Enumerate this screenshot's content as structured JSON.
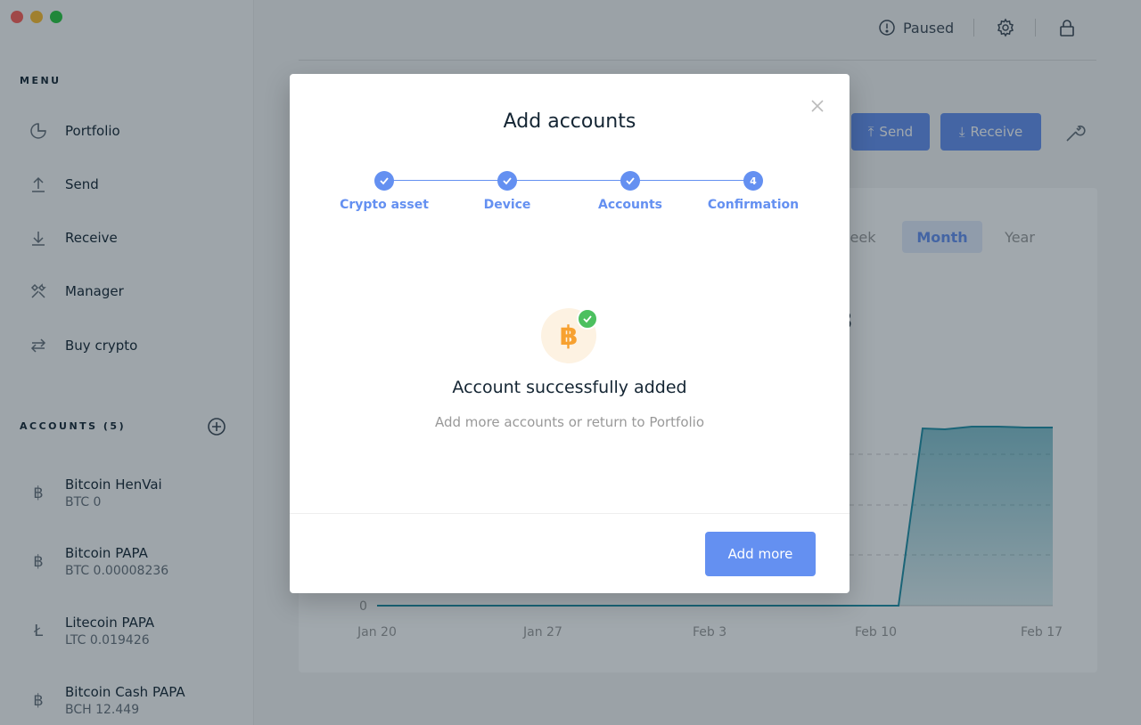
{
  "sidebar": {
    "menu_title": "MENU",
    "menu_items": [
      {
        "label": "Portfolio",
        "icon": "pie-chart-icon"
      },
      {
        "label": "Send",
        "icon": "arrow-up-icon"
      },
      {
        "label": "Receive",
        "icon": "arrow-down-icon"
      },
      {
        "label": "Manager",
        "icon": "tools-icon"
      },
      {
        "label": "Buy crypto",
        "icon": "swap-icon"
      }
    ],
    "accounts_title": "ACCOUNTS (5)",
    "accounts": [
      {
        "name": "Bitcoin HenVai",
        "balance": "BTC 0",
        "icon": "bitcoin-icon",
        "glyph": "฿"
      },
      {
        "name": "Bitcoin PAPA",
        "balance": "BTC 0.00008236",
        "icon": "bitcoin-icon",
        "glyph": "฿"
      },
      {
        "name": "Litecoin PAPA",
        "balance": "LTC 0.019426",
        "icon": "litecoin-icon",
        "glyph": "Ł"
      },
      {
        "name": "Bitcoin Cash PAPA",
        "balance": "BCH 12.449",
        "icon": "bitcoin-cash-icon",
        "glyph": "฿"
      }
    ]
  },
  "topbar": {
    "status": "Paused"
  },
  "main": {
    "send_label": "Send",
    "receive_label": "Receive",
    "ranges": [
      "Week",
      "Month",
      "Year"
    ],
    "range_visible": [
      "eek",
      "Month",
      "Year"
    ],
    "selected_range": "Month",
    "balance_fragment": "3"
  },
  "chart_data": {
    "type": "area",
    "x": [
      "Jan 20",
      "Jan 27",
      "Feb 3",
      "Feb 10",
      "Feb 17"
    ],
    "y_tick_labels": [
      "0"
    ],
    "grid": true,
    "color": "#1e8ea5"
  },
  "modal": {
    "title": "Add accounts",
    "steps": [
      {
        "label": "Crypto asset",
        "state": "done"
      },
      {
        "label": "Device",
        "state": "done"
      },
      {
        "label": "Accounts",
        "state": "done"
      },
      {
        "label": "Confirmation",
        "state": "current",
        "number": "4"
      }
    ],
    "coin_glyph": "฿",
    "success_title": "Account successfully added",
    "success_subtitle": "Add more accounts or return to Portfolio",
    "add_more_label": "Add more"
  },
  "colors": {
    "accent": "#6490f1",
    "success": "#4cc05f",
    "bitcoin": "#f7a130"
  }
}
